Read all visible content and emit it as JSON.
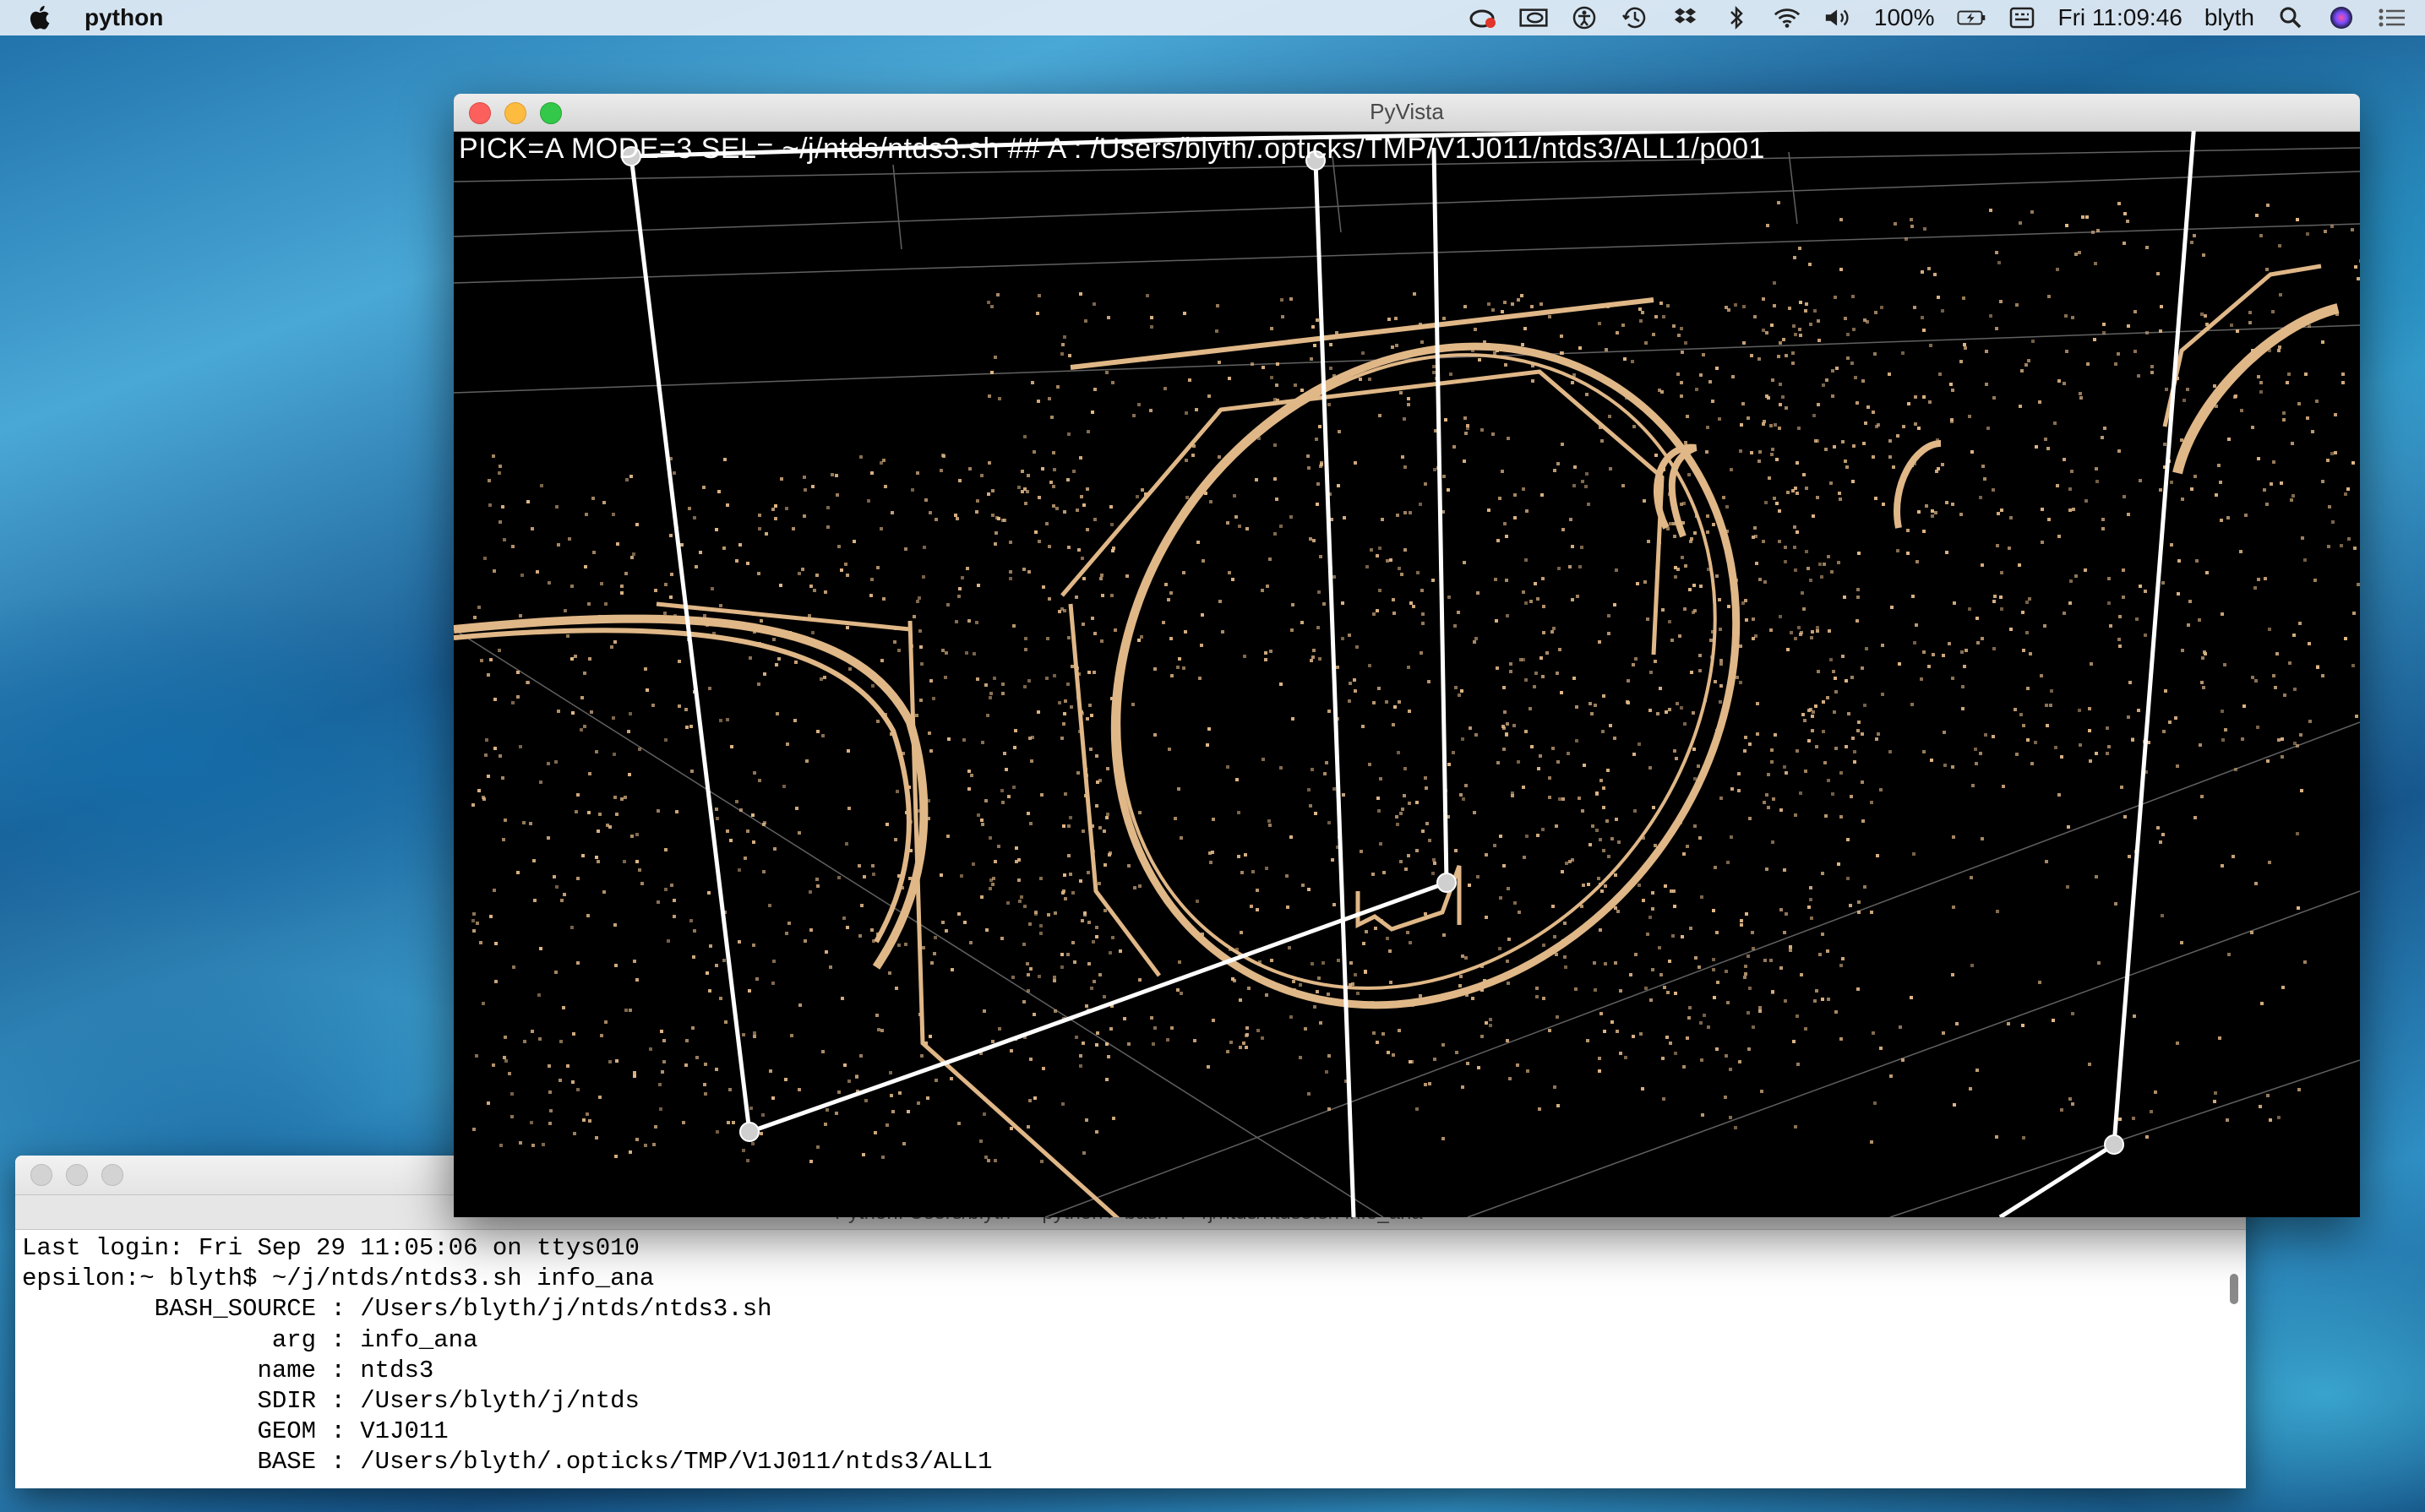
{
  "menubar": {
    "app_name": "python",
    "battery": "100%",
    "clock": "Fri 11:09:46",
    "user": "blyth",
    "icons": [
      "apple-icon",
      "creative-cloud-icon",
      "nvidia-icon",
      "accessibility-icon",
      "time-machine-icon",
      "dropbox-icon",
      "bluetooth-icon",
      "wifi-icon",
      "volume-icon",
      "battery-icon",
      "input-menu-icon",
      "spotlight-icon",
      "siri-icon",
      "notification-center-icon"
    ]
  },
  "pyvista": {
    "title": "PyVista",
    "overlay_text": "PICK=A MODE=3 SEL= ~/j/ntds/ntds3.sh  ## A : /Users/blyth/.opticks/TMP/V1J011/ntds3/ALL1/p001",
    "colors": {
      "points": "#e0b787",
      "lines": "#ffffff",
      "background": "#000000"
    }
  },
  "terminal": {
    "title": "Python: Users/blyth — python ▸ bash -l ~/j/ntds/ntds3.sh info_ana",
    "lines": [
      "Last login: Fri Sep 29 11:05:06 on ttys010",
      "epsilon:~ blyth$ ~/j/ntds/ntds3.sh info_ana",
      "         BASH_SOURCE : /Users/blyth/j/ntds/ntds3.sh",
      "                 arg : info_ana",
      "                name : ntds3",
      "                SDIR : /Users/blyth/j/ntds",
      "                GEOM : V1J011",
      "                BASE : /Users/blyth/.opticks/TMP/V1J011/ntds3/ALL1"
    ]
  }
}
